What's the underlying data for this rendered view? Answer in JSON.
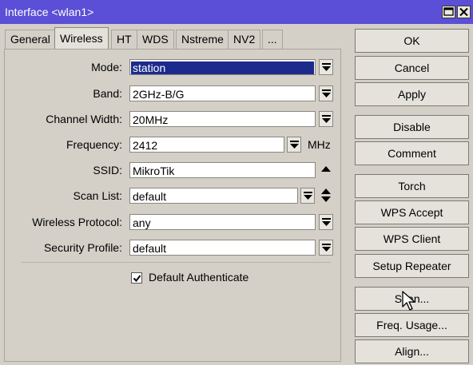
{
  "window": {
    "title": "Interface <wlan1>"
  },
  "titlebar": {
    "maximize_icon": "maximize-icon",
    "close_icon": "close-icon"
  },
  "tabs": [
    "General",
    "Wireless",
    "HT",
    "WDS",
    "Nstreme",
    "NV2",
    "..."
  ],
  "active_tab": "Wireless",
  "form": {
    "mode": {
      "label": "Mode:",
      "value": "station"
    },
    "band": {
      "label": "Band:",
      "value": "2GHz-B/G"
    },
    "channel_width": {
      "label": "Channel Width:",
      "value": "20MHz"
    },
    "frequency": {
      "label": "Frequency:",
      "value": "2412",
      "unit": "MHz"
    },
    "ssid": {
      "label": "SSID:",
      "value": "MikroTik"
    },
    "scan_list": {
      "label": "Scan List:",
      "value": "default"
    },
    "wireless_protocol": {
      "label": "Wireless Protocol:",
      "value": "any"
    },
    "security_profile": {
      "label": "Security Profile:",
      "value": "default"
    },
    "default_authenticate": {
      "label": "Default Authenticate",
      "checked": true
    }
  },
  "buttons": {
    "ok": "OK",
    "cancel": "Cancel",
    "apply": "Apply",
    "disable": "Disable",
    "comment": "Comment",
    "torch": "Torch",
    "wps_accept": "WPS Accept",
    "wps_client": "WPS Client",
    "setup_repeater": "Setup Repeater",
    "scan": "Scan...",
    "freq_usage": "Freq. Usage...",
    "align": "Align..."
  },
  "colors": {
    "titlebar": "#5a4fd6",
    "selection": "#1c2a8c",
    "face": "#d4d0c8"
  }
}
